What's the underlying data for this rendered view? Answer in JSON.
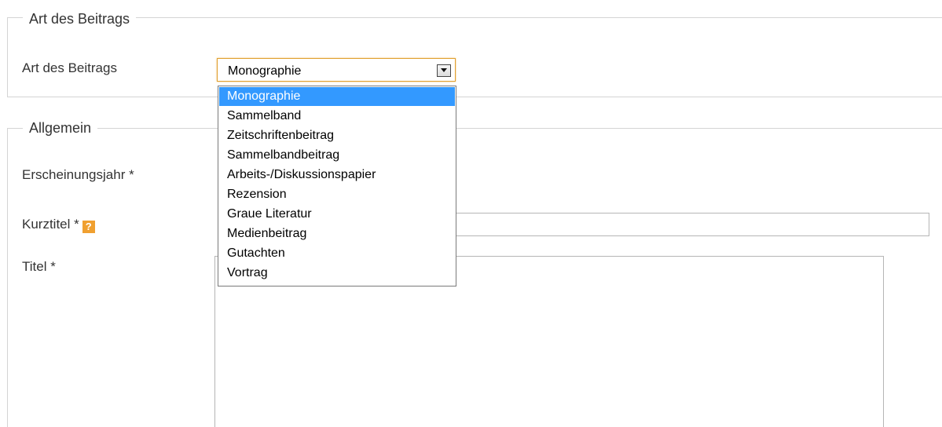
{
  "section_art": {
    "legend": "Art des Beitrags",
    "label": "Art des Beitrags",
    "select": {
      "value": "Monographie",
      "options": [
        "Monographie",
        "Sammelband",
        "Zeitschriftenbeitrag",
        "Sammelbandbeitrag",
        "Arbeits-/Diskussionspapier",
        "Rezension",
        "Graue Literatur",
        "Medienbeitrag",
        "Gutachten",
        "Vortrag"
      ],
      "highlighted_option": "Monographie"
    }
  },
  "section_allgemein": {
    "legend": "Allgemein",
    "fields": {
      "erscheinungsjahr": {
        "label": "Erscheinungsjahr *"
      },
      "kurztitel": {
        "label": "Kurztitel *",
        "help_icon_text": "?",
        "help_icon": "help-icon"
      },
      "titel": {
        "label": "Titel *"
      }
    }
  },
  "colors": {
    "highlight": "#3399ff",
    "focus_border": "#e0a030",
    "help_icon_bg": "#f0a030"
  }
}
